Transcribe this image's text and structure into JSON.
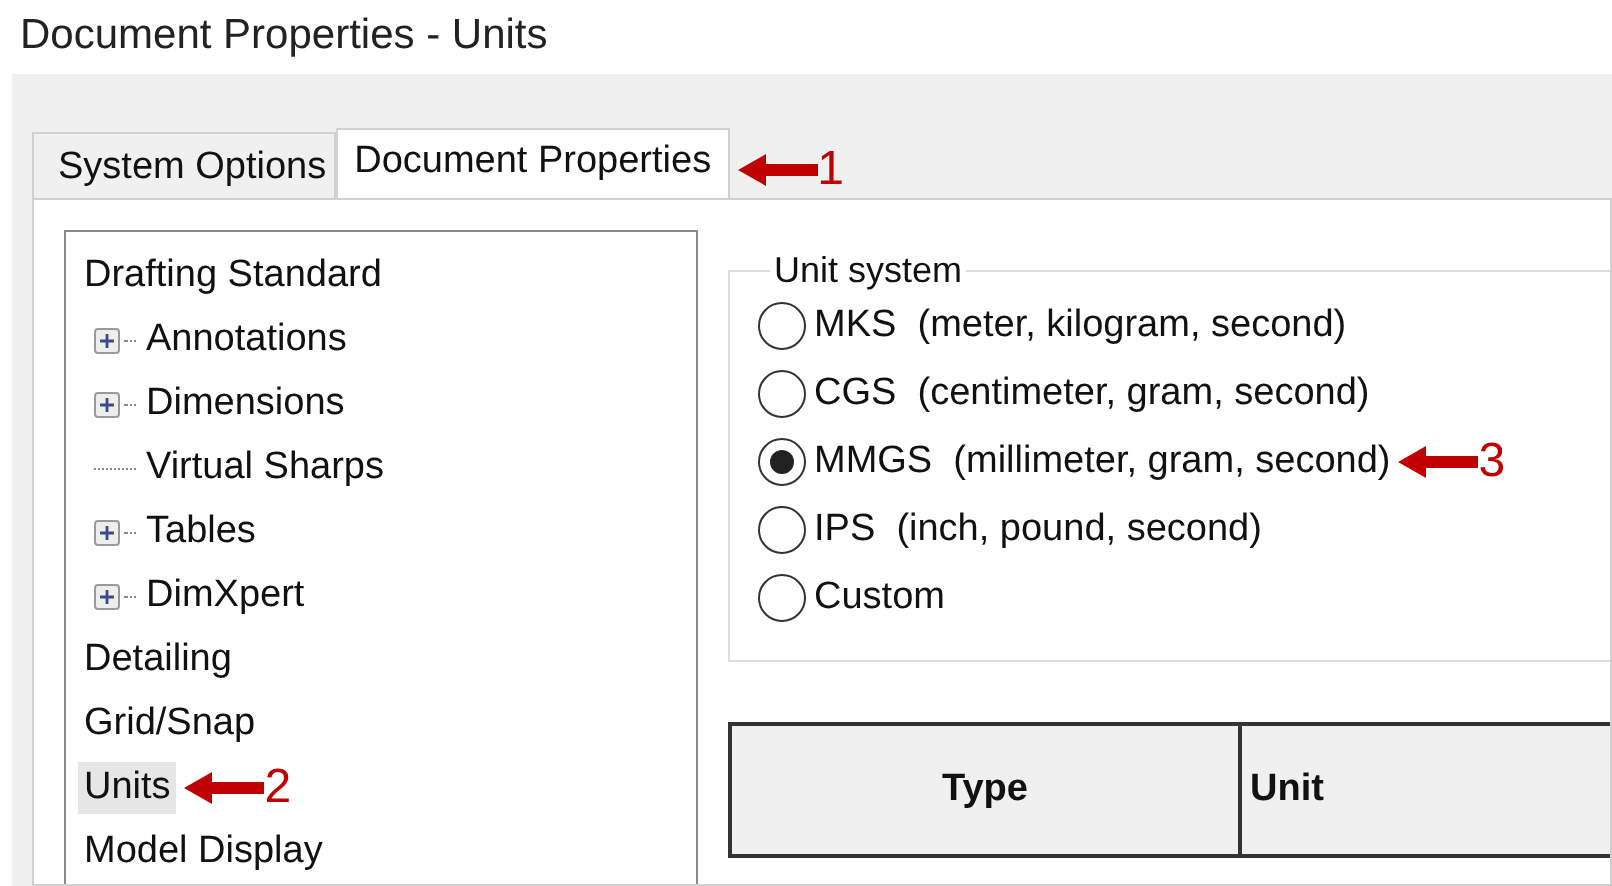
{
  "window": {
    "title": "Document Properties - Units"
  },
  "tabs": [
    {
      "label": "System Options",
      "selected": false
    },
    {
      "label": "Document Properties",
      "selected": true,
      "callout": "1"
    }
  ],
  "tree": {
    "items": [
      {
        "label": "Drafting Standard",
        "selected": false,
        "children": [
          {
            "label": "Annotations",
            "selected": false,
            "expanded": false
          },
          {
            "label": "Dimensions",
            "selected": false,
            "expanded": false
          },
          {
            "label": "Virtual Sharps",
            "selected": false
          },
          {
            "label": "Tables",
            "selected": false,
            "expanded": false
          },
          {
            "label": "DimXpert",
            "selected": false,
            "expanded": false
          }
        ]
      },
      {
        "label": "Detailing",
        "selected": false
      },
      {
        "label": "Grid/Snap",
        "selected": false
      },
      {
        "label": "Units",
        "selected": true,
        "callout": "2"
      },
      {
        "label": "Model Display",
        "selected": false
      }
    ]
  },
  "unit_system": {
    "title": "Unit system",
    "options": [
      {
        "code": "MKS",
        "label": "(meter, kilogram, second)",
        "selected": false
      },
      {
        "code": "CGS",
        "label": "(centimeter, gram, second)",
        "selected": false
      },
      {
        "code": "MMGS",
        "label": "(millimeter, gram, second)",
        "selected": true,
        "callout": "3"
      },
      {
        "code": "IPS",
        "label": "(inch, pound, second)",
        "selected": false
      },
      {
        "code": "Custom",
        "selected": false
      }
    ]
  },
  "table": {
    "columns": [
      "Type",
      "Unit"
    ]
  }
}
